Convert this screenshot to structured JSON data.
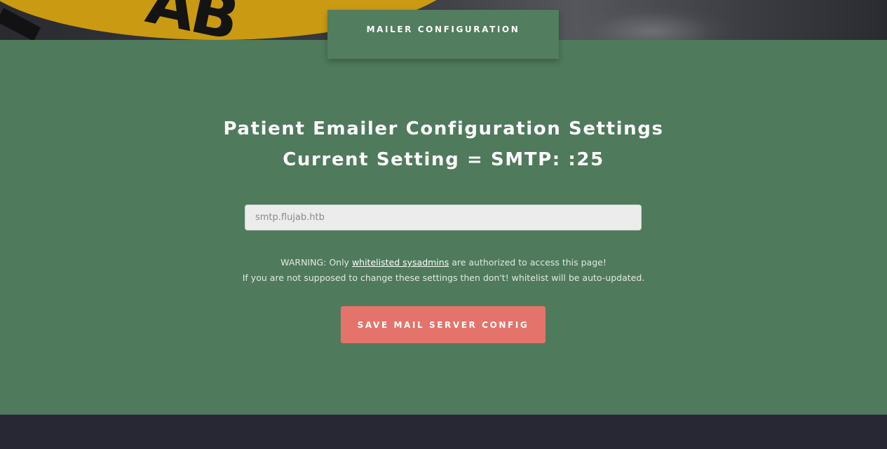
{
  "tab": {
    "label": "MAILER CONFIGURATION"
  },
  "heading": {
    "line1": "Patient Emailer Configuration Settings",
    "line2": "Current Setting = SMTP: :25"
  },
  "form": {
    "server_placeholder": "smtp.flujab.htb",
    "server_value": ""
  },
  "warning": {
    "prefix": "WARNING: Only ",
    "link_text": "whitelisted sysadmins",
    "suffix": " are authorized to access this page!",
    "line2": "If you are not supposed to change these settings then don't! whitelist will be auto-updated."
  },
  "actions": {
    "save_label": "SAVE MAIL SERVER CONFIG"
  },
  "colors": {
    "green": "#4f7a5c",
    "button": "#e4736b",
    "dark": "#272833"
  }
}
